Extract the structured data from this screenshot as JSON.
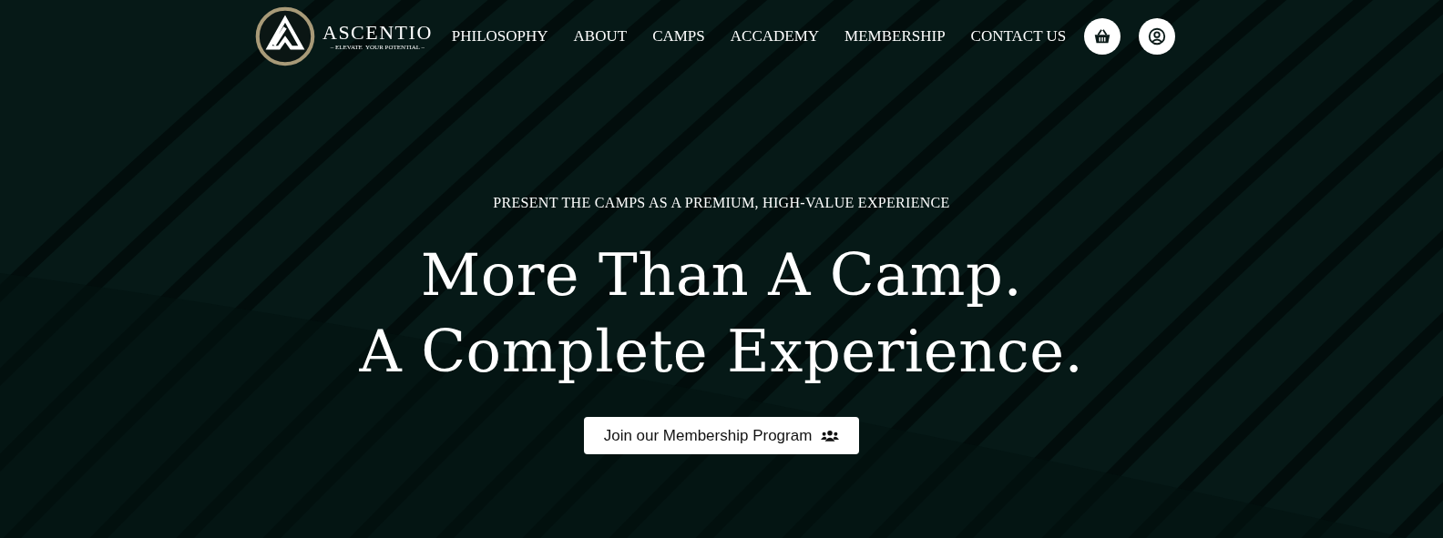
{
  "brand": {
    "name": "ASCENTIO",
    "tagline": "– ELEVATE  YOUR POTENTIAL –"
  },
  "nav": [
    "PHILOSOPHY",
    "ABOUT",
    "CAMPS",
    "ACCADEMY",
    "MEMBERSHIP",
    "CONTACT US"
  ],
  "hero": {
    "eyebrow": "PRESENT THE CAMPS AS A PREMIUM, HIGH-VALUE EXPERIENCE",
    "headline": [
      "More Than A Camp.",
      "A Complete Experience."
    ],
    "button": "Join our Membership Program"
  }
}
